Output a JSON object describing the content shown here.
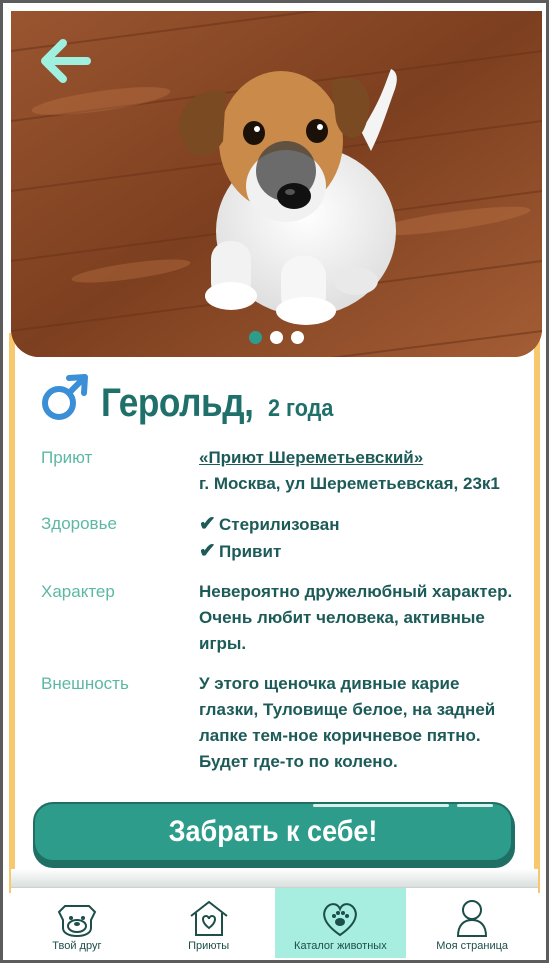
{
  "colors": {
    "primary": "#2d9c8a",
    "dark_teal": "#1f6f6a",
    "label_teal": "#5cb8a4",
    "accent_yellow": "#f7c86e",
    "tab_active": "#a8eee0",
    "male_blue": "#3b8fd6"
  },
  "photo": {
    "icon": "puppy-photo",
    "slide_count": 3,
    "active_slide": 1
  },
  "pet": {
    "name": "Герольд,",
    "age": "2 года",
    "gender_icon": "male-icon"
  },
  "details": {
    "shelter_label": "Приют",
    "shelter_name": "«Приют Шереметьевский»",
    "shelter_address": "г. Москва, ул Шереметьевская, 23к1",
    "health_label": "Здоровье",
    "health_items": [
      "Стерилизован",
      "Привит"
    ],
    "character_label": "Характер",
    "character_text": "Невероятно дружелюбный характер. Очень любит человека, активные игры.",
    "appearance_label": "Внешность",
    "appearance_text": "У этого щеночка дивные карие глазки, Туловище белое, на задней лапке тем-ное коричневое пятно. Будет где-то по колено."
  },
  "cta": {
    "label": "Забрать к себе!"
  },
  "tabs": [
    {
      "label": "Твой друг",
      "icon": "dog-face-icon",
      "active": false
    },
    {
      "label": "Приюты",
      "icon": "house-heart-icon",
      "active": false
    },
    {
      "label": "Каталог животных",
      "icon": "heart-paw-icon",
      "active": true
    },
    {
      "label": "Моя страница",
      "icon": "user-icon",
      "active": false
    }
  ]
}
